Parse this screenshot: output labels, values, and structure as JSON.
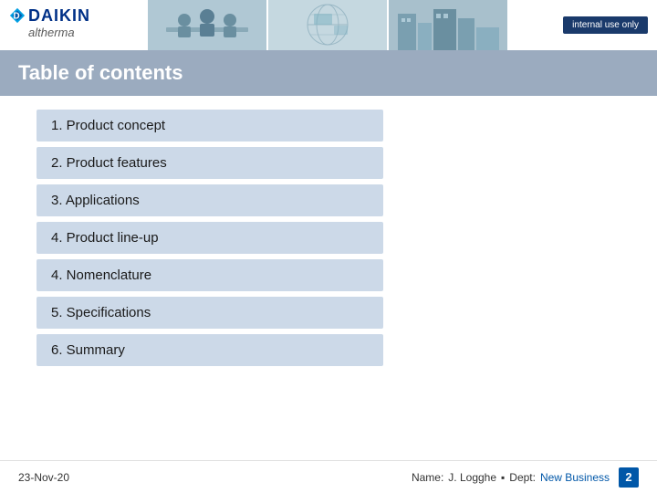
{
  "header": {
    "internal_badge": "internal use only"
  },
  "title_bar": {
    "title": "Table of contents"
  },
  "toc": {
    "items": [
      {
        "label": "1. Product concept"
      },
      {
        "label": "2. Product features"
      },
      {
        "label": "3. Applications"
      },
      {
        "label": "4. Product line-up"
      },
      {
        "label": "4. Nomenclature"
      },
      {
        "label": "5. Specifications"
      },
      {
        "label": "6. Summary"
      }
    ]
  },
  "footer": {
    "date": "23-Nov-20",
    "name_label": "Name:",
    "name_value": "J. Logghe",
    "dept_separator": "▪",
    "dept_label": "Dept:",
    "dept_value": "New Business",
    "page_number": "2"
  }
}
